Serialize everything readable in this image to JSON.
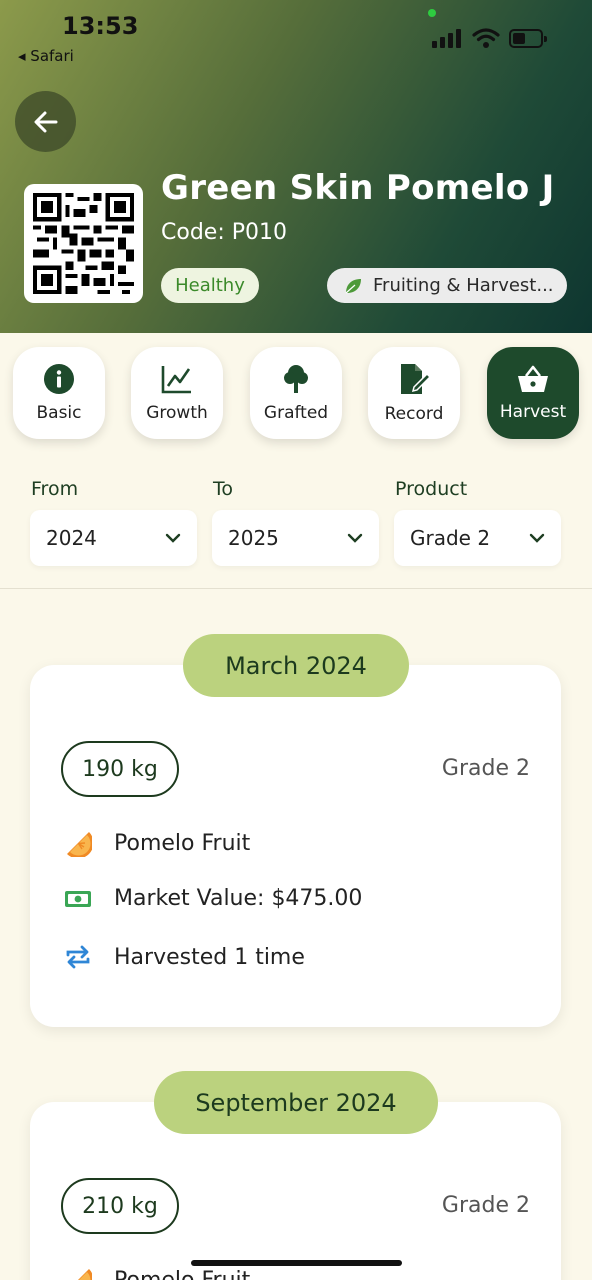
{
  "status_bar": {
    "time": "13:53",
    "back_app": "◂ Safari"
  },
  "header": {
    "title": "Green Skin Pomelo J",
    "code": "Code: P010",
    "health": "Healthy",
    "stage": "Fruiting & Harvest..."
  },
  "tabs": [
    {
      "label": "Basic",
      "icon": "info-icon"
    },
    {
      "label": "Growth",
      "icon": "chart-icon"
    },
    {
      "label": "Grafted",
      "icon": "tree-icon"
    },
    {
      "label": "Record",
      "icon": "edit-icon"
    },
    {
      "label": "Harvest",
      "icon": "basket-icon",
      "active": true
    }
  ],
  "filters": {
    "from_label": "From",
    "from_value": "2024",
    "to_label": "To",
    "to_value": "2025",
    "product_label": "Product",
    "product_value": "Grade 2"
  },
  "harvests": [
    {
      "month": "March 2024",
      "weight": "190 kg",
      "grade": "Grade 2",
      "product": "Pomelo Fruit",
      "value": "Market Value: $475.00",
      "count": "Harvested 1 time"
    },
    {
      "month": "September 2024",
      "weight": "210 kg",
      "grade": "Grade 2",
      "product": "Pomelo Fruit"
    }
  ],
  "colors": {
    "accent": "#1e4a2c",
    "pill": "#bbd27e",
    "health_text": "#3b8a2a",
    "background": "#fbf8ea"
  }
}
